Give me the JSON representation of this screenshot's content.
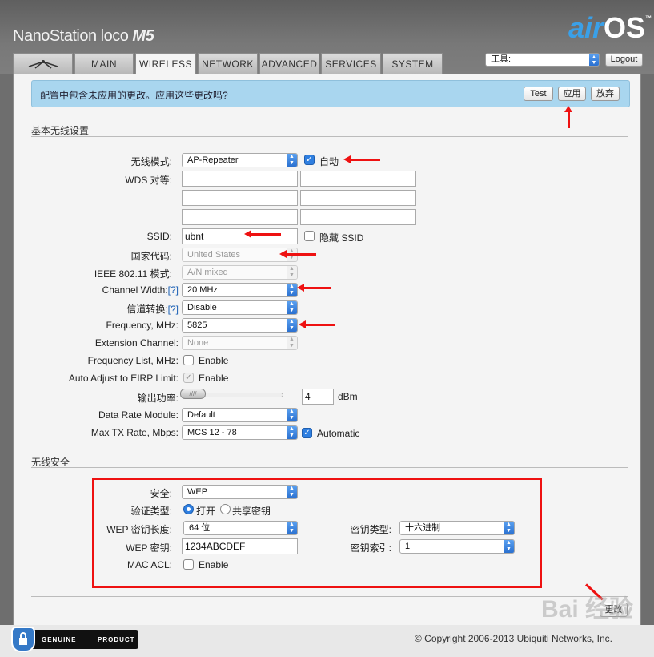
{
  "header": {
    "product_name": "NanoStation",
    "product_suffix": "loco",
    "product_model": "M5",
    "os_prefix": "air",
    "os_name": "OS",
    "os_tm": "™"
  },
  "tabs": [
    {
      "label": "",
      "icon": "ubnt-logo-icon"
    },
    {
      "label": "MAIN"
    },
    {
      "label": "WIRELESS",
      "active": true
    },
    {
      "label": "NETWORK"
    },
    {
      "label": "ADVANCED"
    },
    {
      "label": "SERVICES"
    },
    {
      "label": "SYSTEM"
    }
  ],
  "tools": {
    "selected": "工具:"
  },
  "logout_label": "Logout",
  "notice": {
    "message": "配置中包含未应用的更改。应用这些更改吗?",
    "test_label": "Test",
    "apply_label": "应用",
    "discard_label": "放弃"
  },
  "basic": {
    "title": "基本无线设置",
    "wireless_mode_label": "无线模式:",
    "wireless_mode_value": "AP-Repeater",
    "auto_label": "自动",
    "wds_label": "WDS 对等:",
    "ssid_label": "SSID:",
    "ssid_value": "ubnt",
    "hide_ssid_label": "隐藏 SSID",
    "country_label": "国家代码:",
    "country_value": "United States",
    "ieee_label": "IEEE 802.11 模式:",
    "ieee_value": "A/N mixed",
    "channel_width_label": "Channel Width:",
    "help_link": "[?]",
    "channel_width_value": "20 MHz",
    "channel_shift_label": "信道转换:",
    "channel_shift_value": "Disable",
    "frequency_label": "Frequency, MHz:",
    "frequency_value": "5825",
    "ext_channel_label": "Extension Channel:",
    "ext_channel_value": "None",
    "freq_list_label": "Frequency List, MHz:",
    "enable_label": "Enable",
    "eirp_label": "Auto Adjust to EIRP Limit:",
    "output_power_label": "输出功率:",
    "output_power_value": "4",
    "output_power_unit": "dBm",
    "data_rate_label": "Data Rate Module:",
    "data_rate_value": "Default",
    "max_tx_label": "Max TX Rate, Mbps:",
    "max_tx_value": "MCS 12 - 78",
    "automatic_label": "Automatic"
  },
  "security": {
    "title": "无线安全",
    "security_label": "安全:",
    "security_value": "WEP",
    "auth_label": "验证类型:",
    "auth_open": "打开",
    "auth_shared": "共享密钥",
    "key_length_label": "WEP 密钥长度:",
    "key_length_value": "64 位",
    "key_type_label": "密钥类型:",
    "key_type_value": "十六进制",
    "wep_key_label": "WEP 密钥:",
    "wep_key_value": "1234ABCDEF",
    "key_index_label": "密钥索引:",
    "key_index_value": "1",
    "mac_acl_label": "MAC ACL:",
    "mac_acl_enable": "Enable"
  },
  "change_label": "更改",
  "footer": {
    "genuine_left": "GENUINE",
    "genuine_right": "PRODUCT",
    "copyright": "© Copyright 2006-2013 Ubiquiti Networks, Inc."
  },
  "watermark": "Bai 经验"
}
